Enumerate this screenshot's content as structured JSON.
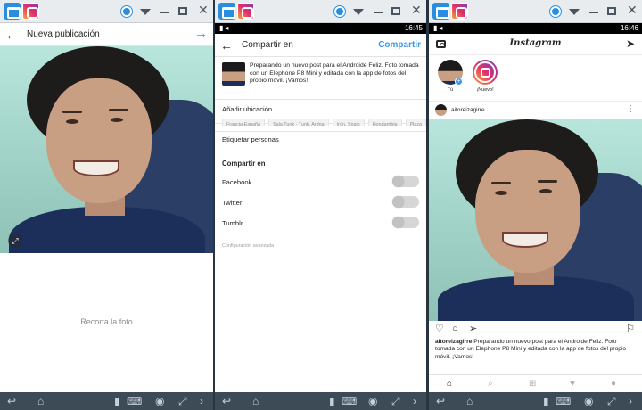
{
  "windows": [
    {
      "status_time": "",
      "header": {
        "title": "Nueva publicación"
      },
      "crop_hint": "Recorta la foto"
    },
    {
      "status_time": "16:45",
      "header": {
        "title": "Compartir en",
        "action": "Compartir"
      },
      "caption": "Preparando un nuevo post para el Androide Feliz. Foto tomada con un Elephone P8 Mini y editada con la app de fotos del propio móvil. ¡Vamos!",
      "add_location": "Añadir ubicación",
      "location_chips": [
        "Francia-España",
        "Sala Tunk - Tunk, Ardoa",
        "Irún, Spain",
        "Hondarribia",
        "Plaza"
      ],
      "tag_people": "Etiquetar personas",
      "share_section": "Compartir en",
      "networks": [
        "Facebook",
        "Twitter",
        "Tumblr"
      ],
      "advanced": "Configuración avanzada"
    },
    {
      "status_time": "16:46",
      "header": {
        "title": "Instagram"
      },
      "stories": [
        {
          "label": "Tú"
        },
        {
          "label": "¡Nuevo!"
        }
      ],
      "post_user": "aitoreizagirre",
      "post_caption_user": "aitoreizagirre",
      "post_caption": "Preparando un nuevo post para el Androide Feliz. Foto tomada con un Elephone P8 Mini y editada con la app de fotos del propio móvil. ¡Vamos!"
    }
  ],
  "colors": {
    "accent": "#3897f0",
    "taskbar": "#3d4b57",
    "text": "#262626",
    "muted": "#8e8e8e"
  },
  "icons": [
    "home-icon",
    "instagram-icon",
    "back-arrow-icon",
    "next-arrow-icon",
    "camera-icon",
    "send-icon",
    "heart-icon",
    "comment-icon",
    "share-icon",
    "bookmark-icon",
    "search-icon",
    "add-icon",
    "profile-icon",
    "more-icon"
  ]
}
